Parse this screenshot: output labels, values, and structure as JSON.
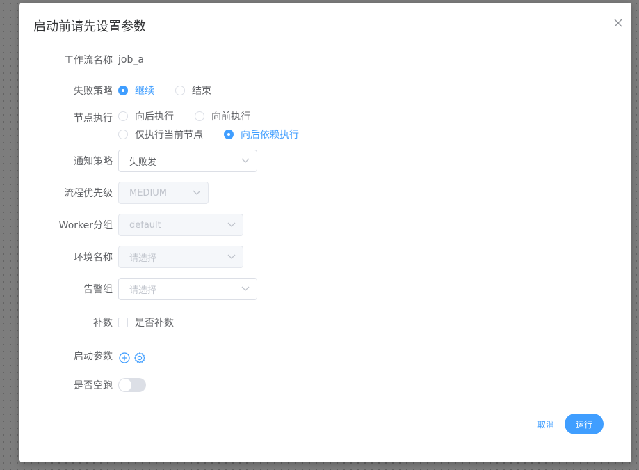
{
  "dialog": {
    "title": "启动前请先设置参数",
    "close_icon": "close-icon"
  },
  "form": {
    "workflow_name": {
      "label": "工作流名称",
      "value": "job_a"
    },
    "failure_strategy": {
      "label": "失败策略",
      "options": [
        {
          "label": "继续",
          "checked": true
        },
        {
          "label": "结束",
          "checked": false
        }
      ]
    },
    "node_execution": {
      "label": "节点执行",
      "options": [
        {
          "label": "向后执行",
          "checked": false
        },
        {
          "label": "向前执行",
          "checked": false
        },
        {
          "label": "仅执行当前节点",
          "checked": false
        },
        {
          "label": "向后依赖执行",
          "checked": true
        }
      ]
    },
    "notify_strategy": {
      "label": "通知策略",
      "value": "失败发"
    },
    "process_priority": {
      "label": "流程优先级",
      "value": "MEDIUM",
      "disabled": true
    },
    "worker_group": {
      "label": "Worker分组",
      "value": "default",
      "disabled": true
    },
    "environment": {
      "label": "环境名称",
      "placeholder": "请选择",
      "disabled": true
    },
    "alert_group": {
      "label": "告警组",
      "placeholder": "请选择"
    },
    "complement": {
      "label": "补数",
      "checkbox_label": "是否补数",
      "checked": false
    },
    "startup_params": {
      "label": "启动参数",
      "add_icon": "plus-circle-icon",
      "settings_icon": "gear-icon"
    },
    "dry_run": {
      "label": "是否空跑",
      "enabled": false
    }
  },
  "footer": {
    "cancel_label": "取消",
    "run_label": "运行"
  },
  "colors": {
    "primary": "#409eff",
    "text": "#606266",
    "title": "#303133",
    "border": "#dcdfe6"
  }
}
